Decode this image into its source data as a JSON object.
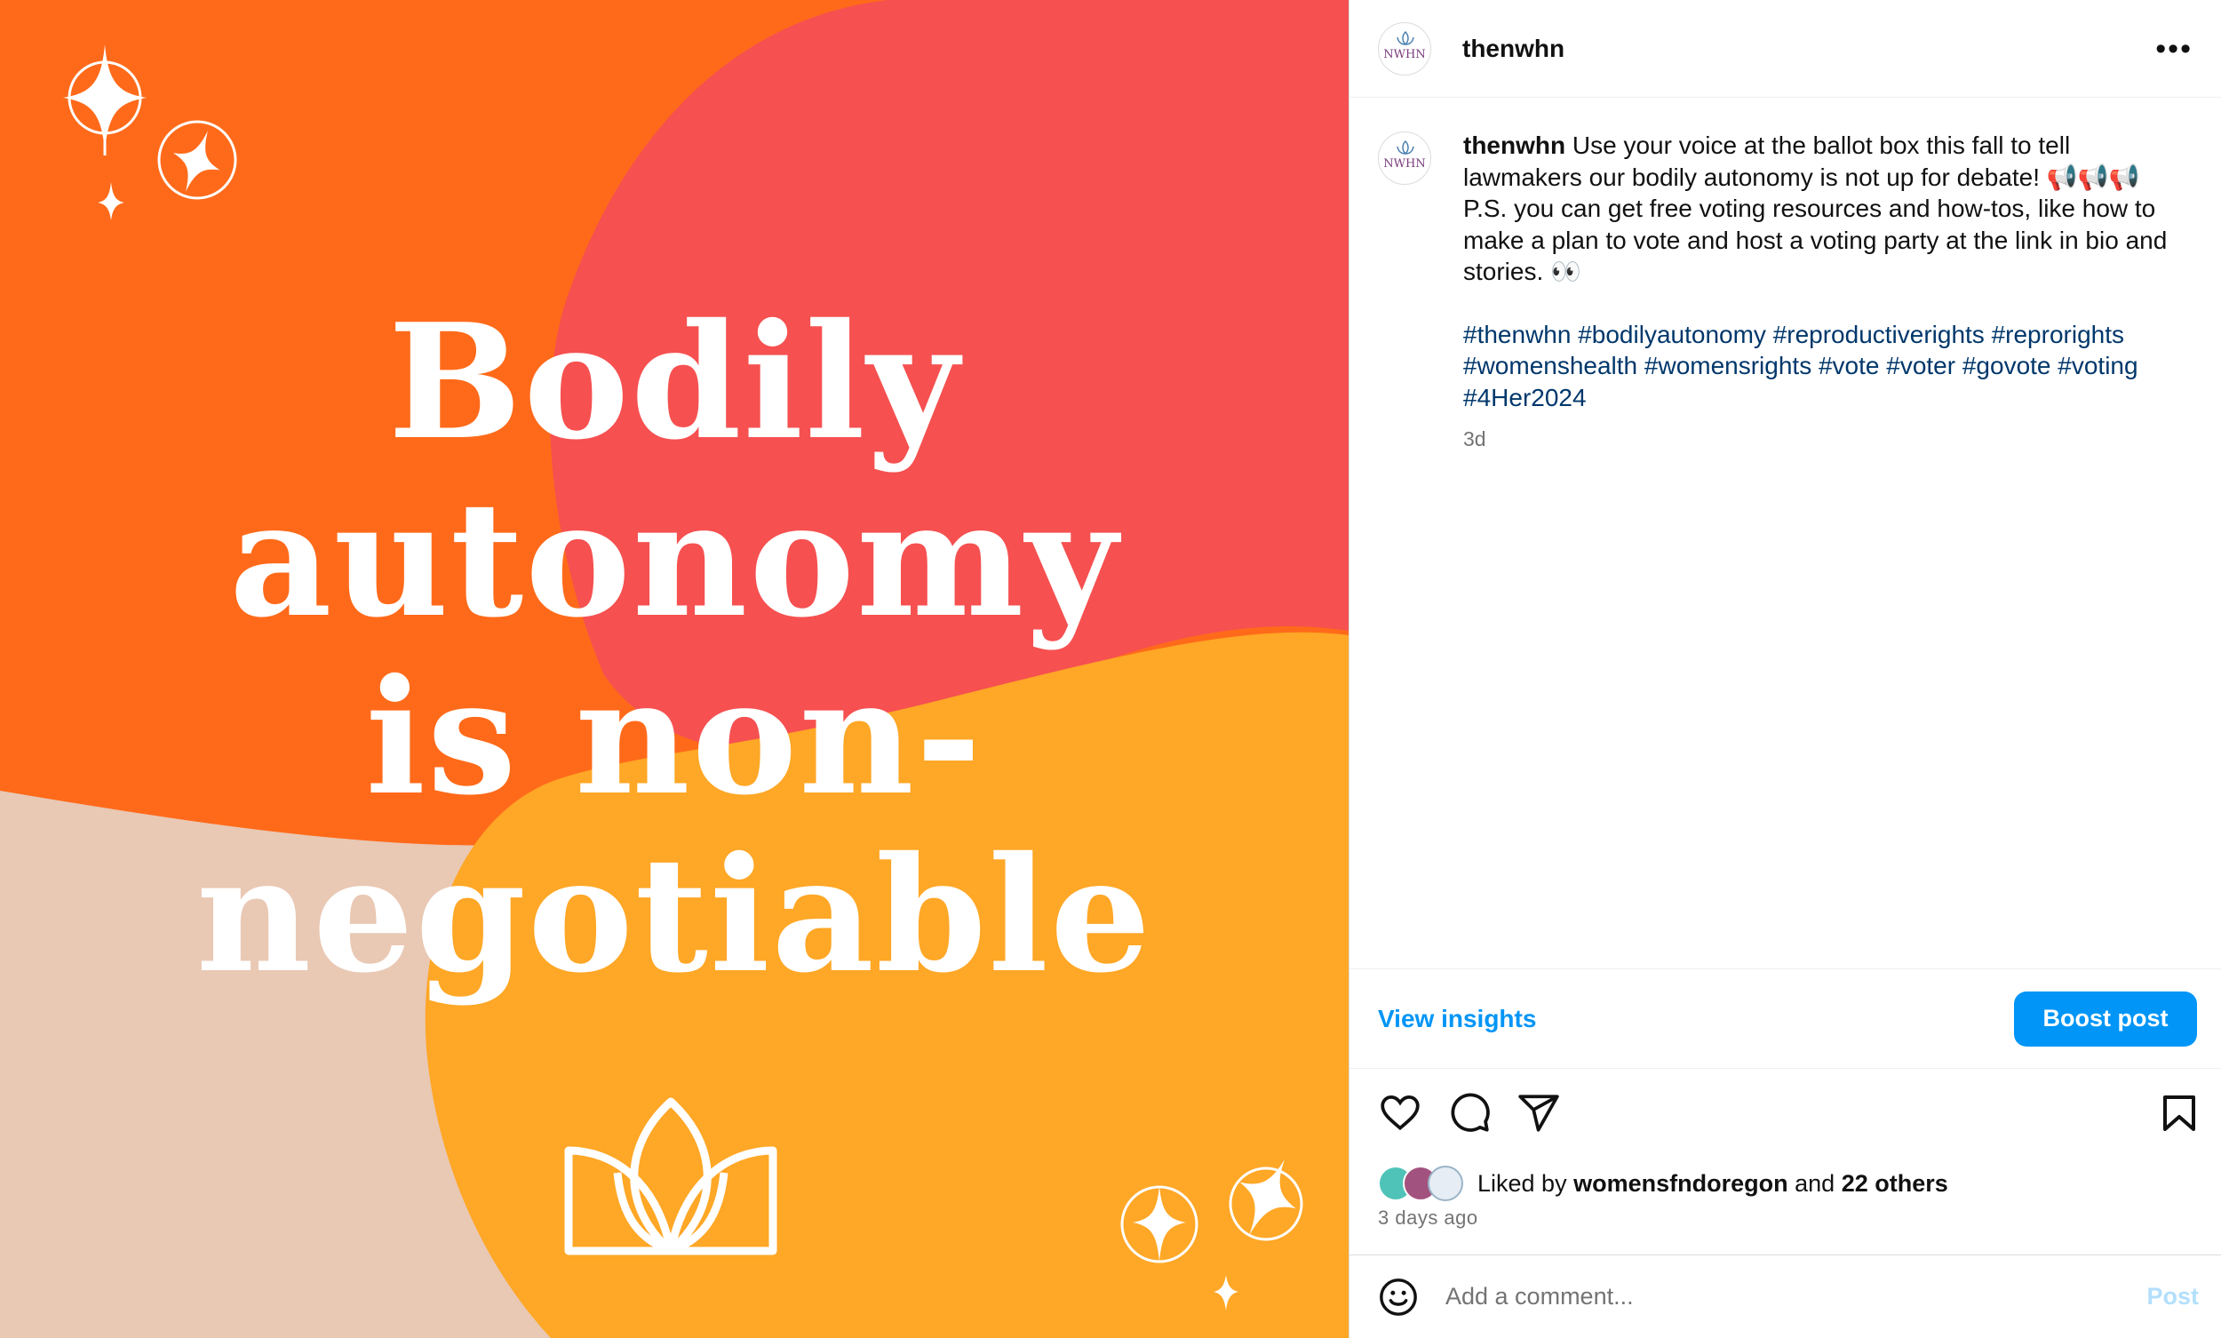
{
  "image": {
    "headline_lines": [
      "Bodily",
      "autonomy",
      "is non-",
      "negotiable"
    ],
    "colors": {
      "orange": "#ff6a1a",
      "coral": "#f65050",
      "amber": "#ffa726",
      "peach": "#e9c8b4",
      "text": "#ffffff"
    }
  },
  "header": {
    "username": "thenwhn",
    "avatar_text": "NWHN",
    "more_label": "•••"
  },
  "caption": {
    "username": "thenwhn",
    "text": "Use your voice at the ballot box this fall to tell lawmakers our bodily autonomy is not up for debate! 📢📢📢 P.S. you can get free voting resources and how-tos, like how to make a plan to vote and host a voting party at the link in bio and stories. 👀",
    "hashtags": "#thenwhn #bodilyautonomy #reproductiverights #reprorights #womenshealth #womensrights #vote #voter #govote #voting #4Her2024",
    "age": "3d"
  },
  "insights": {
    "view_label": "View insights",
    "boost_label": "Boost post"
  },
  "likes": {
    "prefix": "Liked by",
    "user": "womensfndoregon",
    "and": "and",
    "others": "22 others",
    "time": "3 days ago"
  },
  "comment": {
    "placeholder": "Add a comment...",
    "post_label": "Post"
  },
  "icons": [
    "heart-icon",
    "comment-icon",
    "share-icon",
    "bookmark-icon",
    "emoji-icon",
    "more-icon"
  ],
  "accent": "#0095f6"
}
